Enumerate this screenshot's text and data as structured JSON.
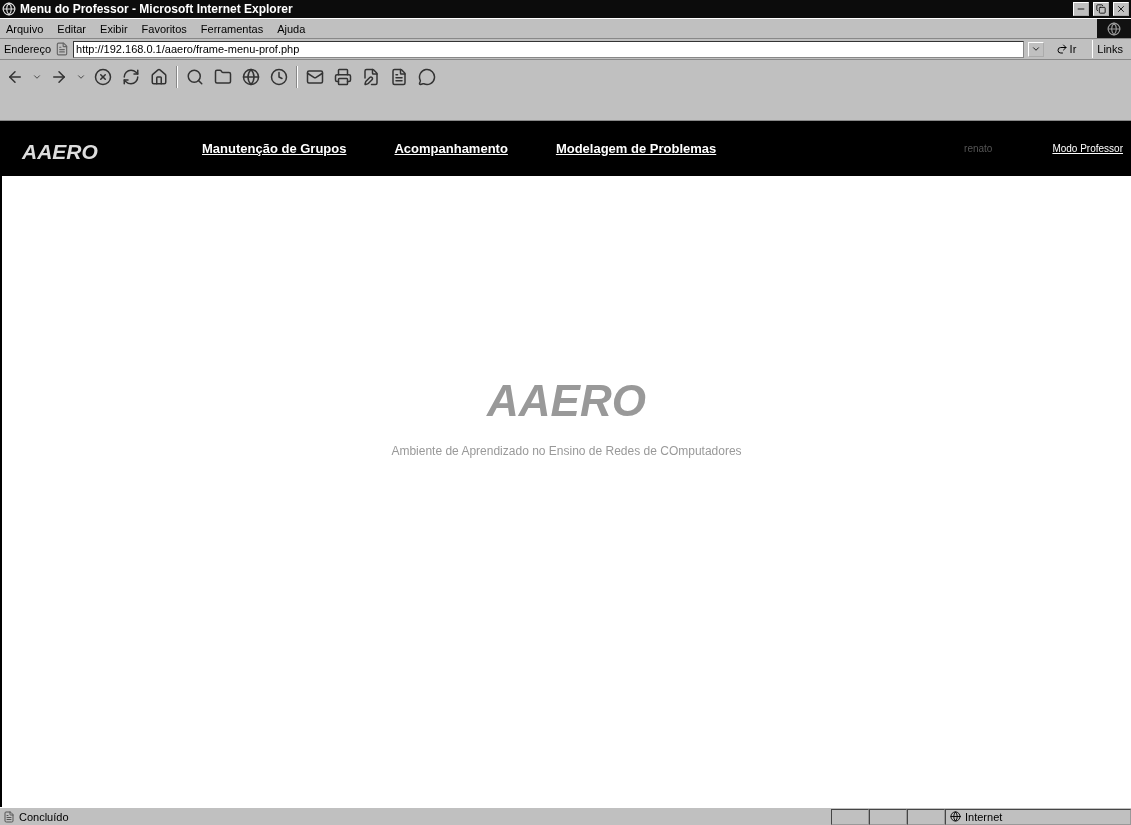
{
  "window": {
    "title": "Menu do Professor - Microsoft Internet Explorer"
  },
  "menu": [
    "Arquivo",
    "Editar",
    "Exibir",
    "Favoritos",
    "Ferramentas",
    "Ajuda"
  ],
  "address_bar": {
    "label": "Endereço",
    "value": "http://192.168.0.1/aaero/frame-menu-prof.php",
    "go": "Ir",
    "links": "Links"
  },
  "site_header": {
    "logo": "AAERO",
    "nav": [
      "Manutenção de Grupos",
      "Acompanhamento",
      "Modelagem de Problemas"
    ],
    "user": "renato",
    "mode_link": "Modo Professor"
  },
  "main": {
    "title": "AAERO",
    "subtitle": "Ambiente de Aprendizado no Ensino de Redes de COmputadores"
  },
  "status_bar": {
    "text": "Concluído",
    "zone": "Internet"
  }
}
